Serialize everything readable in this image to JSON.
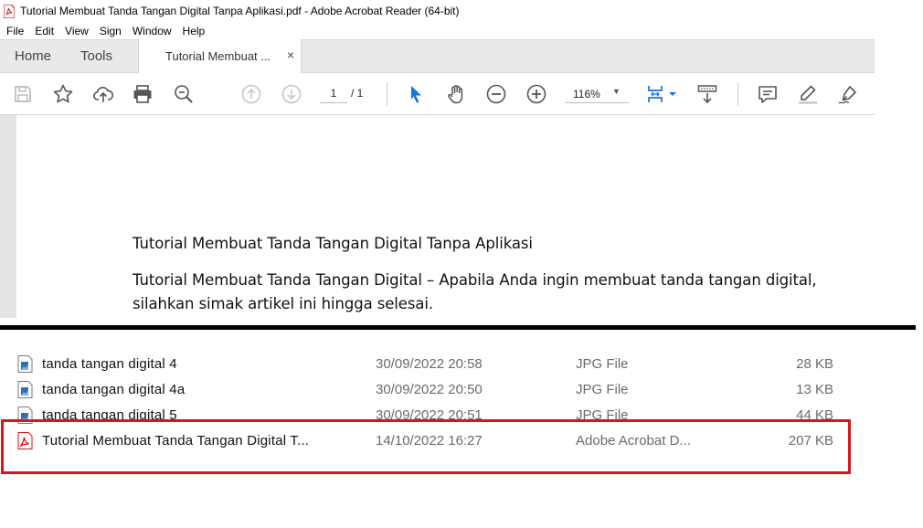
{
  "window": {
    "title": "Tutorial Membuat Tanda Tangan Digital Tanpa Aplikasi.pdf - Adobe Acrobat Reader (64-bit)"
  },
  "menu": {
    "items": [
      "File",
      "Edit",
      "View",
      "Sign",
      "Window",
      "Help"
    ]
  },
  "tabs": {
    "home": "Home",
    "tools": "Tools",
    "document": "Tutorial Membuat ...",
    "close": "×"
  },
  "toolbar": {
    "page_current": "1",
    "page_total": "/ 1",
    "zoom": "116%",
    "icons": [
      "save-icon",
      "star-icon",
      "upload-cloud-icon",
      "print-icon",
      "zoom-search-icon",
      "page-up-icon",
      "page-down-icon",
      "select-cursor-icon",
      "hand-icon",
      "zoom-out-icon",
      "zoom-in-icon",
      "fit-page-icon",
      "scroll-mode-icon",
      "comment-icon",
      "highlight-pen-icon",
      "sign-pen-icon"
    ]
  },
  "document": {
    "heading": "Tutorial Membuat Tanda Tangan Digital Tanpa Aplikasi",
    "paragraph": "Tutorial Membuat Tanda Tangan Digital – Apabila Anda ingin membuat tanda tangan digital, silahkan simak artikel ini hingga selesai."
  },
  "files": [
    {
      "name": "tanda tangan digital 4",
      "date": "30/09/2022 20:58",
      "type": "JPG File",
      "size": "28 KB",
      "icon": "jpg-file-icon"
    },
    {
      "name": "tanda tangan digital 4a",
      "date": "30/09/2022 20:50",
      "type": "JPG File",
      "size": "13 KB",
      "icon": "jpg-file-icon"
    },
    {
      "name": "tanda tangan digital 5",
      "date": "30/09/2022 20:51",
      "type": "JPG File",
      "size": "44 KB",
      "icon": "jpg-file-icon"
    },
    {
      "name": "Tutorial Membuat Tanda Tangan Digital T...",
      "date": "14/10/2022 16:27",
      "type": "Adobe Acrobat D...",
      "size": "207 KB",
      "icon": "pdf-file-icon"
    }
  ],
  "colors": {
    "highlight": "#d9141b",
    "acrobat_red": "#d9141b",
    "accent_blue": "#1473e6"
  }
}
